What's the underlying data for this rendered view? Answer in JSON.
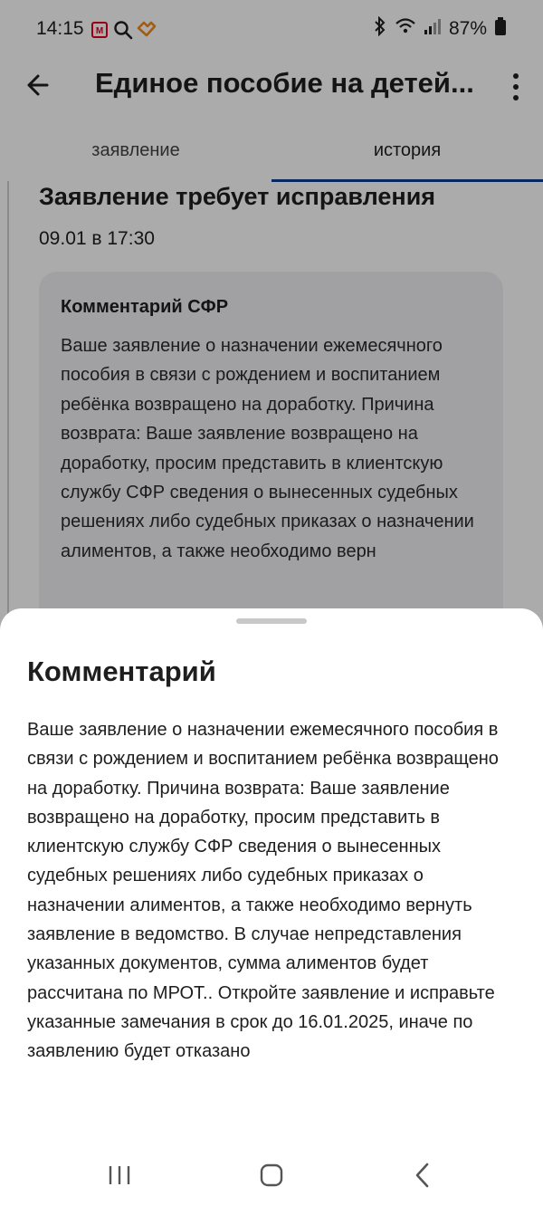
{
  "status_bar": {
    "time": "14:15",
    "battery": "87%",
    "icons": [
      "mts-icon",
      "search-icon",
      "handshake-icon",
      "bluetooth-icon",
      "wifi-icon",
      "signal-icon",
      "battery-icon"
    ]
  },
  "app_bar": {
    "title": "Единое пособие на детей...",
    "back_icon": "back-arrow-icon",
    "more_icon": "more-vertical-icon"
  },
  "tabs": [
    {
      "label": "заявление",
      "active": false
    },
    {
      "label": "история",
      "active": true
    }
  ],
  "history_item": {
    "status": "Заявление требует исправления",
    "date": "09.01 в 17:30",
    "comment_title": "Комментарий СФР",
    "comment_preview": "Ваше заявление о назначении ежемесячного пособия в связи с рождением и воспитанием ребёнка возвращено на доработку. Причина возврата: Ваше заявление возвращено на доработку, просим представить в клиентскую службу СФР сведения о вынесенных судебных решениях либо судебных приказах о назначении алиментов, а также необходимо верн"
  },
  "sheet": {
    "title": "Комментарий",
    "text": "Ваше заявление о назначении ежемесячного пособия в связи с рождением и воспитанием ребёнка возвращено на доработку. Причина возврата: Ваше заявление возвращено на доработку, просим представить в клиентскую службу СФР сведения о вынесенных судебных решениях либо судебных приказах о назначении алиментов, а также необходимо вернуть заявление в ведомство. В случае непредставления указанных документов, сумма алиментов будет рассчитана по МРОТ.. Откройте заявление и исправьте указанные замечания в срок до 16.01.2025, иначе по заявлению будет отказано"
  },
  "colors": {
    "accent": "#0d3b8c",
    "card_bg": "#f0f1f3",
    "scrim": "rgba(0,0,0,0.33)"
  },
  "nav_bar": {
    "icons": [
      "recents-icon",
      "home-icon",
      "back-icon"
    ]
  }
}
